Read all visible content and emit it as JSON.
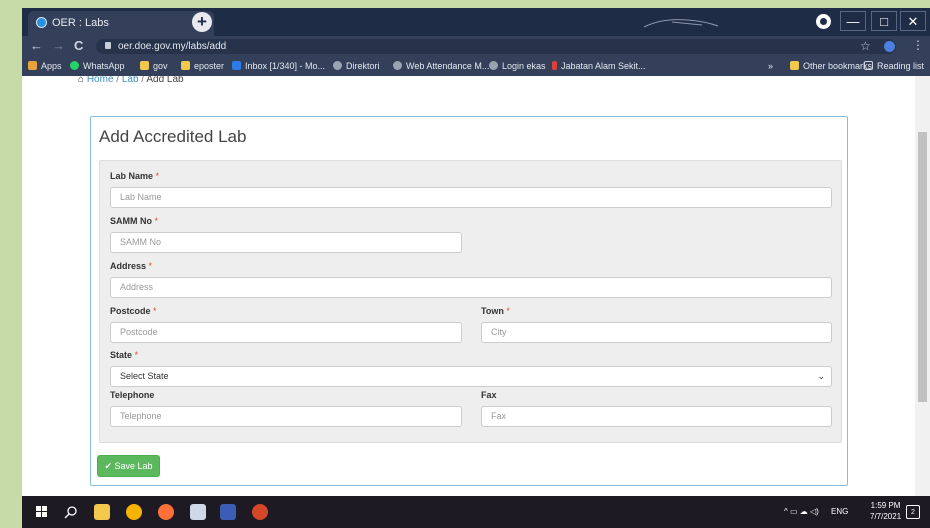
{
  "browser": {
    "tab_title": "OER : Labs",
    "tab_close": "×",
    "new_tab": "+",
    "url": "oer.doe.gov.my/labs/add",
    "window_min": "—",
    "window_max": "□",
    "window_close": "✕",
    "back": "←",
    "forward": "→",
    "reload": "C",
    "star": "☆",
    "menu": "⋮"
  },
  "bookmarks": {
    "items": [
      {
        "label": "Apps",
        "color": "#e8a33d"
      },
      {
        "label": "WhatsApp",
        "color": "#25d366"
      },
      {
        "label": "gov",
        "color": "#f2c94c"
      },
      {
        "label": "eposter",
        "color": "#f2c94c"
      },
      {
        "label": "Inbox [1/340] - Mo...",
        "color": "#2d7be5"
      },
      {
        "label": "Direktori",
        "color": "#9aa3b2"
      },
      {
        "label": "Web Attendance M...",
        "color": "#9aa3b2"
      },
      {
        "label": "Login ekas",
        "color": "#9aa3b2"
      },
      {
        "label": "Jabatan Alam Sekit...",
        "color": "#d9413b"
      }
    ],
    "more": "»",
    "other": "Other bookmarks",
    "reading": "Reading list"
  },
  "breadcrumb": {
    "home": "Home",
    "sep1": "/",
    "lab": "Lab",
    "sep2": "/",
    "current": "Add Lab"
  },
  "form": {
    "title": "Add Accredited Lab",
    "required_mark": "*",
    "lab_name": {
      "label": "Lab Name",
      "placeholder": "Lab Name"
    },
    "samm_no": {
      "label": "SAMM No",
      "placeholder": "SAMM No"
    },
    "address": {
      "label": "Address",
      "placeholder": "Address"
    },
    "postcode": {
      "label": "Postcode",
      "placeholder": "Postcode"
    },
    "town": {
      "label": "Town",
      "placeholder": "City"
    },
    "state": {
      "label": "State",
      "selected": "Select State"
    },
    "telephone": {
      "label": "Telephone",
      "placeholder": "Telephone"
    },
    "fax": {
      "label": "Fax",
      "placeholder": "Fax"
    },
    "save_label": "Save Lab",
    "save_icon": "✔"
  },
  "taskbar": {
    "time": "1:59 PM",
    "date": "7/7/2021",
    "lang": "ENG",
    "notifications": "2"
  },
  "colors": {
    "accent": "#3c8dbc",
    "save": "#5cb85c",
    "required": "#dd4b39"
  }
}
